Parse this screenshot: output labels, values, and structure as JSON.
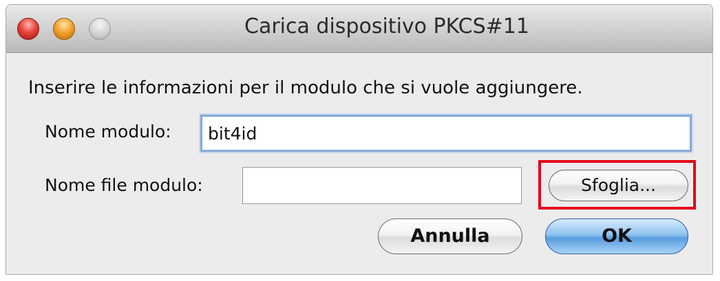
{
  "window": {
    "title": "Carica dispositivo PKCS#11"
  },
  "dialog": {
    "instructions": "Inserire le informazioni per il modulo che si vuole aggiungere.",
    "module_name": {
      "label": "Nome modulo:",
      "value": "bit4id"
    },
    "module_file": {
      "label": "Nome file modulo:",
      "value": ""
    },
    "buttons": {
      "browse": "Sfoglia...",
      "cancel": "Annulla",
      "ok": "OK"
    }
  },
  "colors": {
    "highlight": "#e3001b",
    "default_button": "#5a9de0",
    "focus_ring": "#86a9d6"
  }
}
